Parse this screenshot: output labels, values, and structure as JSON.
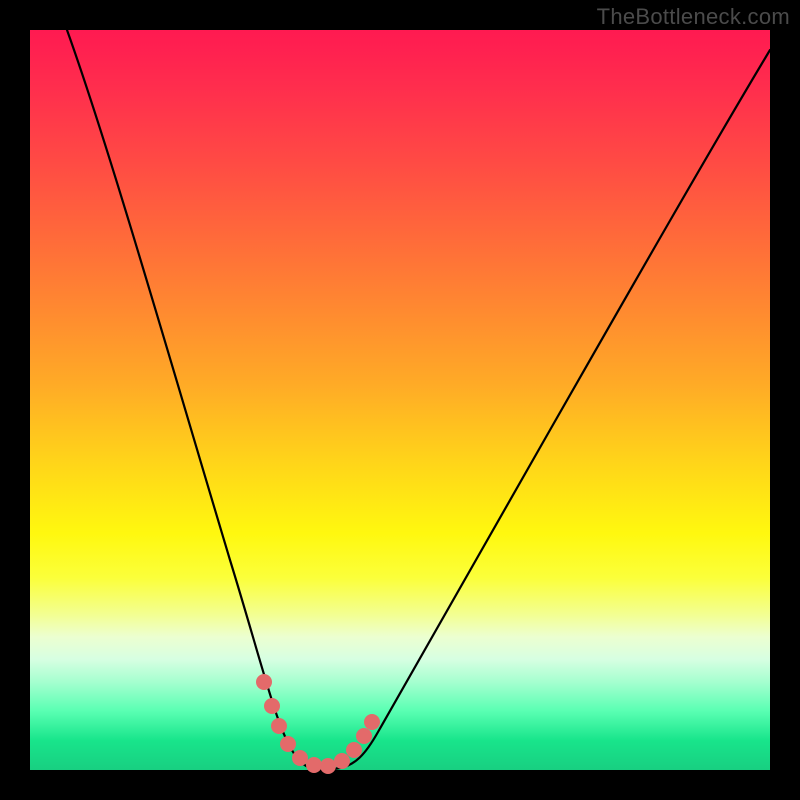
{
  "watermark": "TheBottleneck.com",
  "chart_data": {
    "type": "line",
    "title": "",
    "xlabel": "",
    "ylabel": "",
    "xlim": [
      0,
      100
    ],
    "ylim": [
      0,
      100
    ],
    "grid": false,
    "series": [
      {
        "name": "bottleneck-curve",
        "color": "#000000",
        "x": [
          5,
          10,
          15,
          20,
          25,
          28,
          30,
          32,
          34,
          36,
          38,
          40,
          42,
          44,
          46,
          50,
          55,
          60,
          65,
          70,
          75,
          80,
          85,
          90,
          95,
          100
        ],
        "values": [
          100,
          84,
          68,
          52,
          36,
          26,
          19,
          12,
          6,
          3,
          1,
          0,
          0,
          1,
          3,
          8,
          15,
          22,
          29,
          36,
          43,
          50,
          58,
          66,
          74,
          82
        ]
      },
      {
        "name": "highlight-dots",
        "color": "#e36a6a",
        "x": [
          31.5,
          32.5,
          33.5,
          35,
          37,
          39,
          41,
          43,
          44.5,
          45.5,
          46.5
        ],
        "values": [
          12,
          9,
          6,
          3,
          1,
          0,
          0,
          1,
          3,
          5,
          7
        ]
      }
    ],
    "background_gradient_stops": [
      {
        "pos": 0,
        "color": "#ff1a51"
      },
      {
        "pos": 28,
        "color": "#ff6a3a"
      },
      {
        "pos": 58,
        "color": "#ffd31a"
      },
      {
        "pos": 82,
        "color": "#ecffd0"
      },
      {
        "pos": 96,
        "color": "#18e58b"
      },
      {
        "pos": 100,
        "color": "#18cf81"
      }
    ]
  }
}
